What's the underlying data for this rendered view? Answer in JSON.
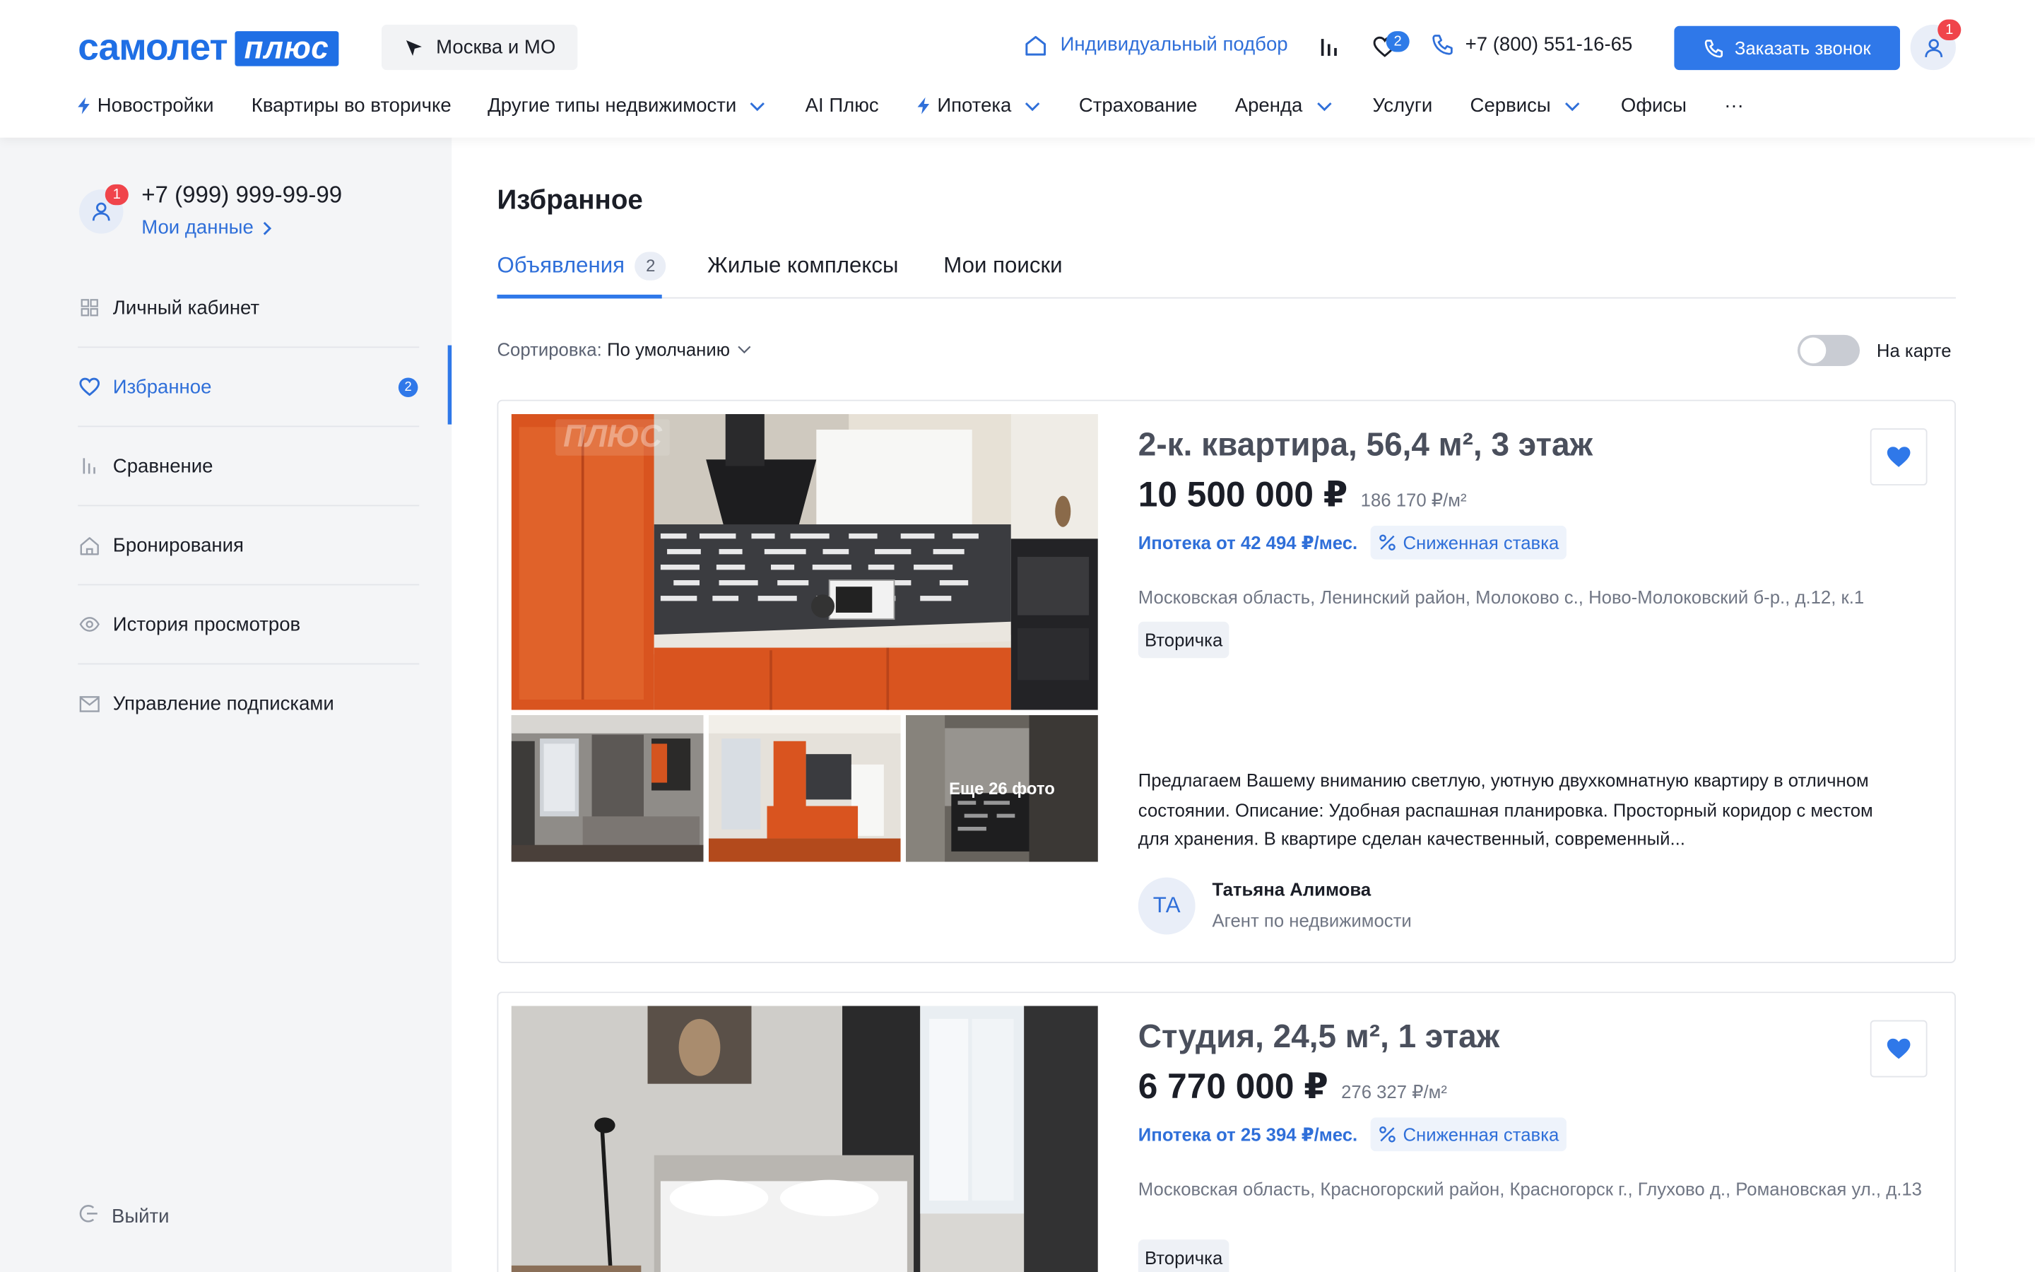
{
  "header": {
    "logo_word": "самолет",
    "logo_plus": "плюс",
    "region": "Москва и МО",
    "individual_selection": "Индивидуальный подбор",
    "favorites_count": "2",
    "phone": "+7 (800) 551-16-65",
    "call_button": "Заказать звонок",
    "profile_badge": "1",
    "nav": [
      {
        "label": "Новостройки"
      },
      {
        "label": "Квартиры во вторичке"
      },
      {
        "label": "Другие типы недвижимости"
      },
      {
        "label": "AI Плюс"
      },
      {
        "label": "Ипотека"
      },
      {
        "label": "Страхование"
      },
      {
        "label": "Аренда"
      },
      {
        "label": "Услуги"
      },
      {
        "label": "Сервисы"
      },
      {
        "label": "Офисы"
      },
      {
        "label": "···"
      }
    ]
  },
  "sidebar": {
    "user_badge": "1",
    "phone": "+7 (999) 999-99-99",
    "my_data": "Мои данные",
    "items": [
      {
        "label": "Личный кабинет",
        "icon": "grid-icon"
      },
      {
        "label": "Избранное",
        "icon": "heart-icon",
        "badge": "2",
        "active": true
      },
      {
        "label": "Сравнение",
        "icon": "bars-icon"
      },
      {
        "label": "Бронирования",
        "icon": "home-icon"
      },
      {
        "label": "История просмотров",
        "icon": "eye-icon"
      },
      {
        "label": "Управление подписками",
        "icon": "mail-icon"
      }
    ],
    "logout": "Выйти"
  },
  "main": {
    "title": "Избранное",
    "tabs": [
      {
        "label": "Объявления",
        "count": "2",
        "active": true
      },
      {
        "label": "Жилые комплексы"
      },
      {
        "label": "Мои поиски"
      }
    ],
    "sort_label": "Сортировка:",
    "sort_value": "По умолчанию",
    "map_toggle_label": "На карте",
    "map_toggle_on": false
  },
  "listings": [
    {
      "title": "2-к. квартира, 56,4 м², 3 этаж",
      "price": "10 500 000 ₽",
      "price_per_m2": "186 170 ₽/м²",
      "mortgage": "Ипотека от 42 494 ₽/мес.",
      "rate_chip": "Сниженная ставка",
      "address": "Московская область, Ленинский район, Молоково с., Ново-Молоковский б-р., д.12, к.1",
      "tag": "Вторичка",
      "watermark": "ПЛЮС",
      "more_photos": "Еще 26 фото",
      "description": "Предлагаем Вашему вниманию светлую, уютную двухкомнатную квартиру в отличном состоянии. Описание: Удобная распашная планировка. Просторный коридор с местом для хранения. В квартире сделан качественный, современный...",
      "agent_initials": "ТА",
      "agent_name": "Татьяна Алимова",
      "agent_role": "Агент по недвижимости"
    },
    {
      "title": "Студия, 24,5 м², 1 этаж",
      "price": "6 770 000 ₽",
      "price_per_m2": "276 327 ₽/м²",
      "mortgage": "Ипотека от 25 394 ₽/мес.",
      "rate_chip": "Сниженная ставка",
      "address": "Московская область, Красногорский район, Красногорск г., Глухово д., Романовская ул., д.13",
      "tag": "Вторичка"
    }
  ],
  "colors": {
    "brand": "#1f6fe5",
    "accent": "#2f78e9",
    "link": "#2f6fd9",
    "badge_red": "#f0444b",
    "sidebar_bg": "#f4f5f7"
  }
}
